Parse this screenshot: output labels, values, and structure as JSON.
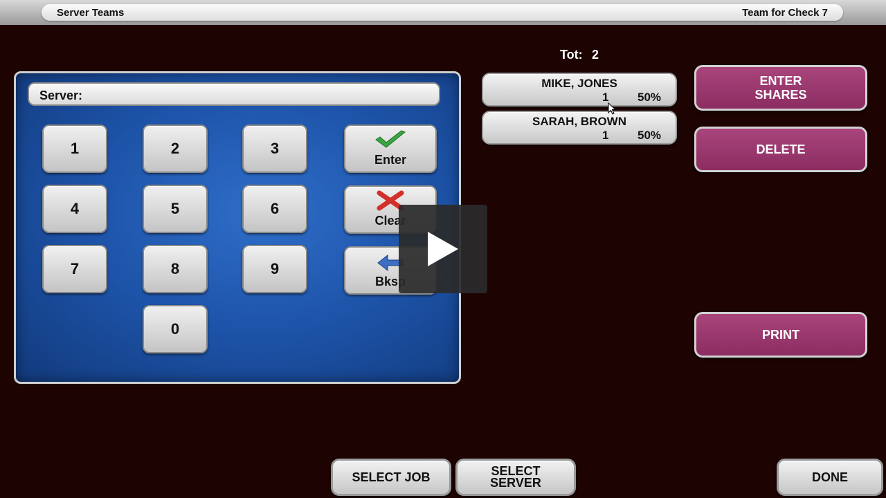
{
  "header": {
    "title_left": "Server Teams",
    "title_right": "Team for Check 7"
  },
  "total": {
    "label": "Tot:",
    "value": "2"
  },
  "keypad": {
    "field_label": "Server:",
    "digits": [
      "1",
      "2",
      "3",
      "4",
      "5",
      "6",
      "7",
      "8",
      "9",
      "0"
    ],
    "enter_label": "Enter",
    "clear_label": "Clear",
    "backspace_label": "Bksp",
    "enter_icon": "checkmark-icon",
    "clear_icon": "x-icon",
    "backspace_icon": "left-arrow-icon"
  },
  "servers": [
    {
      "name": "MIKE, JONES",
      "count": "1",
      "percent": "50%"
    },
    {
      "name": "SARAH, BROWN",
      "count": "1",
      "percent": "50%"
    }
  ],
  "actions": {
    "enter_shares_line1": "ENTER",
    "enter_shares_line2": "SHARES",
    "delete": "DELETE",
    "print": "PRINT"
  },
  "bottom": {
    "select_job": "SELECT JOB",
    "select_server_line1": "SELECT",
    "select_server_line2": "SERVER",
    "done": "DONE"
  },
  "colors": {
    "background": "#1e0303",
    "accent": "#9a3b70",
    "panel": "#1d53a8"
  },
  "overlay": {
    "icon": "play-icon"
  }
}
